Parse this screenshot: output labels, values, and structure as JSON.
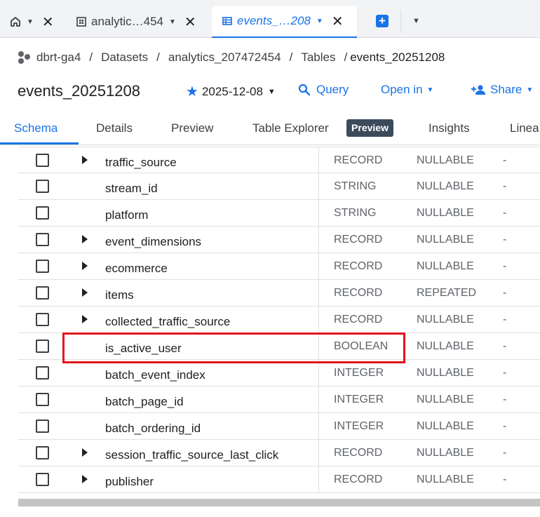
{
  "tabs": {
    "home_icon": "home-icon",
    "analytics_label": "analytic…454",
    "events_label": "events_…208"
  },
  "breadcrumb": {
    "project": "dbrt-ga4",
    "datasets": "Datasets",
    "dataset": "analytics_207472454",
    "tables": "Tables",
    "table": "events_20251208",
    "separator": "/"
  },
  "header": {
    "title": "events_20251208",
    "snapshot_date": "2025-12-08",
    "query_label": "Query",
    "open_in_label": "Open in",
    "share_label": "Share"
  },
  "subtabs": {
    "schema": "Schema",
    "details": "Details",
    "preview": "Preview",
    "table_explorer": "Table Explorer",
    "preview_badge": "Preview",
    "insights": "Insights",
    "lineage": "Linea"
  },
  "schema_rows": [
    {
      "name": "traffic_source",
      "type": "RECORD",
      "mode": "NULLABLE",
      "desc": "-",
      "expandable": true
    },
    {
      "name": "stream_id",
      "type": "STRING",
      "mode": "NULLABLE",
      "desc": "-",
      "expandable": false
    },
    {
      "name": "platform",
      "type": "STRING",
      "mode": "NULLABLE",
      "desc": "-",
      "expandable": false
    },
    {
      "name": "event_dimensions",
      "type": "RECORD",
      "mode": "NULLABLE",
      "desc": "-",
      "expandable": true
    },
    {
      "name": "ecommerce",
      "type": "RECORD",
      "mode": "NULLABLE",
      "desc": "-",
      "expandable": true
    },
    {
      "name": "items",
      "type": "RECORD",
      "mode": "REPEATED",
      "desc": "-",
      "expandable": true
    },
    {
      "name": "collected_traffic_source",
      "type": "RECORD",
      "mode": "NULLABLE",
      "desc": "-",
      "expandable": true
    },
    {
      "name": "is_active_user",
      "type": "BOOLEAN",
      "mode": "NULLABLE",
      "desc": "-",
      "expandable": false
    },
    {
      "name": "batch_event_index",
      "type": "INTEGER",
      "mode": "NULLABLE",
      "desc": "-",
      "expandable": false
    },
    {
      "name": "batch_page_id",
      "type": "INTEGER",
      "mode": "NULLABLE",
      "desc": "-",
      "expandable": false
    },
    {
      "name": "batch_ordering_id",
      "type": "INTEGER",
      "mode": "NULLABLE",
      "desc": "-",
      "expandable": false
    },
    {
      "name": "session_traffic_source_last_click",
      "type": "RECORD",
      "mode": "NULLABLE",
      "desc": "-",
      "expandable": true
    },
    {
      "name": "publisher",
      "type": "RECORD",
      "mode": "NULLABLE",
      "desc": "-",
      "expandable": true
    }
  ],
  "colors": {
    "accent": "#1a73e8",
    "highlight": "#e0161e"
  }
}
